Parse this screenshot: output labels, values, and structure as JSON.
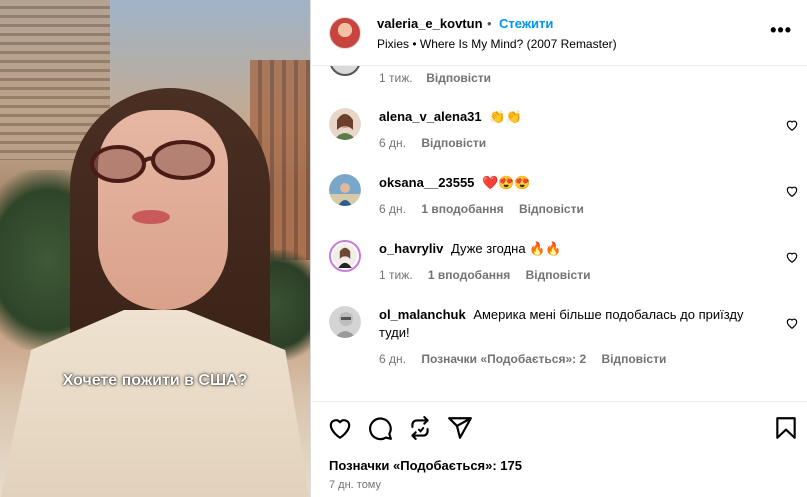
{
  "post": {
    "username": "valeria_e_kovtun",
    "separator": "•",
    "follow_label": "Стежити",
    "audio": "Pixies • Where Is My Mind? (2007 Remaster)",
    "more_label": "•••",
    "caption_overlay": "Хочете пожити в США?"
  },
  "partial_comment": {
    "time": "1 тиж.",
    "reply_label": "Відповісти"
  },
  "comments": [
    {
      "username": "alena_v_alena31",
      "text": "👏👏",
      "time": "6 дн.",
      "likes": "",
      "reply_label": "Відповісти"
    },
    {
      "username": "oksana__23555",
      "text": "❤️😍😍",
      "time": "6 дн.",
      "likes": "1 вподобання",
      "reply_label": "Відповісти"
    },
    {
      "username": "o_havryliv",
      "text": "Дуже згодна 🔥🔥",
      "time": "1 тиж.",
      "likes": "1 вподобання",
      "reply_label": "Відповісти"
    },
    {
      "username": "ol_malanchuk",
      "text": "Америка мені більше подобалась до приїзду туди!",
      "time": "6 дн.",
      "likes": "Позначки «Подобається»: 2",
      "reply_label": "Відповісти"
    }
  ],
  "actions": {
    "likes_text": "Позначки «Подобається»: 175",
    "posted_time": "7 дн. тому"
  },
  "icons": {
    "like": "heart-icon",
    "comment": "comment-icon",
    "repost": "repost-icon",
    "share": "send-icon",
    "save": "bookmark-icon"
  },
  "colors": {
    "link_blue": "#0095f6",
    "meta_gray": "#737373"
  }
}
